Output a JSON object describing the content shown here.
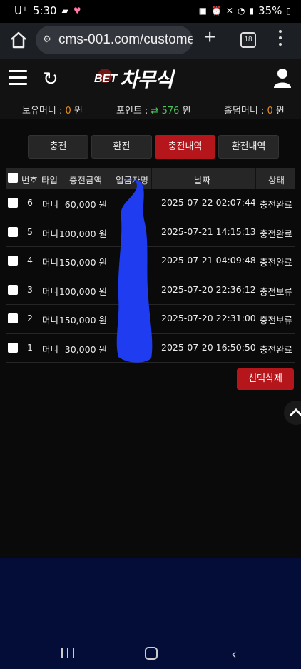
{
  "statusbar": {
    "carrier": "U⁺",
    "time": "5:30",
    "battery": "35%"
  },
  "browser": {
    "url": "cms-001.com/custome",
    "tab_count": "18"
  },
  "site": {
    "logo_prefix": "BET",
    "logo_text": "차무식"
  },
  "balance": {
    "money_label": "보유머니 :",
    "money_value": "0",
    "money_unit": "원",
    "point_label": "포인트 :",
    "point_value": "576",
    "point_unit": "원",
    "holdem_label": "홀덤머니 :",
    "holdem_value": "0",
    "holdem_unit": "원"
  },
  "tabs": [
    "충전",
    "환전",
    "충전내역",
    "환전내역"
  ],
  "active_tab": "충전내역",
  "table": {
    "headers": [
      "번호",
      "타입",
      "충전금액",
      "입금자명",
      "날짜",
      "상태"
    ],
    "rows": [
      {
        "no": "6",
        "type": "머니",
        "amount": "60,000 원",
        "date": "2025-07-22 02:07:44",
        "status": "충전완료"
      },
      {
        "no": "5",
        "type": "머니",
        "amount": "100,000 원",
        "date": "2025-07-21 14:15:13",
        "status": "충전완료"
      },
      {
        "no": "4",
        "type": "머니",
        "amount": "150,000 원",
        "date": "2025-07-21 04:09:48",
        "status": "충전완료"
      },
      {
        "no": "3",
        "type": "머니",
        "amount": "100,000 원",
        "date": "2025-07-20 22:36:12",
        "status": "충전보류"
      },
      {
        "no": "2",
        "type": "머니",
        "amount": "150,000 원",
        "date": "2025-07-20 22:31:00",
        "status": "충전보류"
      },
      {
        "no": "1",
        "type": "머니",
        "amount": "30,000 원",
        "date": "2025-07-20 16:50:50",
        "status": "충전완료"
      }
    ]
  },
  "actions": {
    "delete_selected": "선택삭제"
  },
  "colors": {
    "accent_red": "#b4161b",
    "money_orange": "#e68a1f",
    "point_green": "#4cc35a",
    "redaction_blue": "#1f3cf0"
  }
}
